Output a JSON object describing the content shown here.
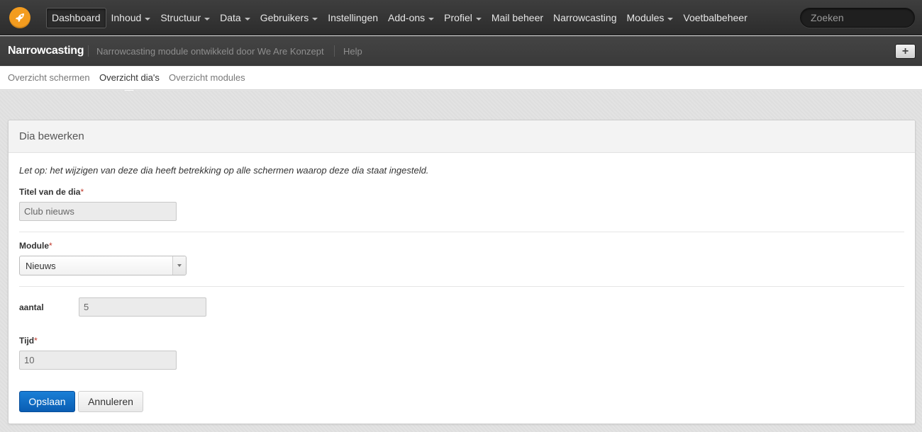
{
  "topnav": {
    "items": [
      {
        "label": "Dashboard",
        "dropdown": false,
        "active": true
      },
      {
        "label": "Inhoud",
        "dropdown": true
      },
      {
        "label": "Structuur",
        "dropdown": true
      },
      {
        "label": "Data",
        "dropdown": true
      },
      {
        "label": "Gebruikers",
        "dropdown": true
      },
      {
        "label": "Instellingen",
        "dropdown": false
      },
      {
        "label": "Add-ons",
        "dropdown": true
      },
      {
        "label": "Profiel",
        "dropdown": true
      },
      {
        "label": "Mail beheer",
        "dropdown": false
      },
      {
        "label": "Narrowcasting",
        "dropdown": false
      },
      {
        "label": "Modules",
        "dropdown": true
      },
      {
        "label": "Voetbalbeheer",
        "dropdown": false
      }
    ],
    "search_placeholder": "Zoeken",
    "logo_icon": "rocket-icon",
    "logo_color": "#f39c1f"
  },
  "module_bar": {
    "title": "Narrowcasting",
    "description": "Narrowcasting module ontwikkeld door We Are Konzept",
    "help_label": "Help",
    "plus_label": "+"
  },
  "subnav": {
    "items": [
      {
        "label": "Overzicht schermen"
      },
      {
        "label": "Overzicht dia's",
        "active": true
      },
      {
        "label": "Overzicht modules"
      }
    ]
  },
  "panel": {
    "title": "Dia bewerken",
    "notice": "Let op: het wijzigen van deze dia heeft betrekking op alle schermen waarop deze dia staat ingesteld.",
    "fields": {
      "titel": {
        "label": "Titel van de dia",
        "required_mark": "*",
        "value": "Club nieuws"
      },
      "module": {
        "label": "Module",
        "required_mark": "*",
        "value": "Nieuws"
      },
      "aantal": {
        "label": "aantal",
        "value": "5"
      },
      "tijd": {
        "label": "Tijd",
        "required_mark": "*",
        "value": "10"
      }
    },
    "buttons": {
      "save_label": "Opslaan",
      "cancel_label": "Annuleren"
    }
  },
  "colors": {
    "accent": "#1a7fd6",
    "required": "#c0392b"
  }
}
